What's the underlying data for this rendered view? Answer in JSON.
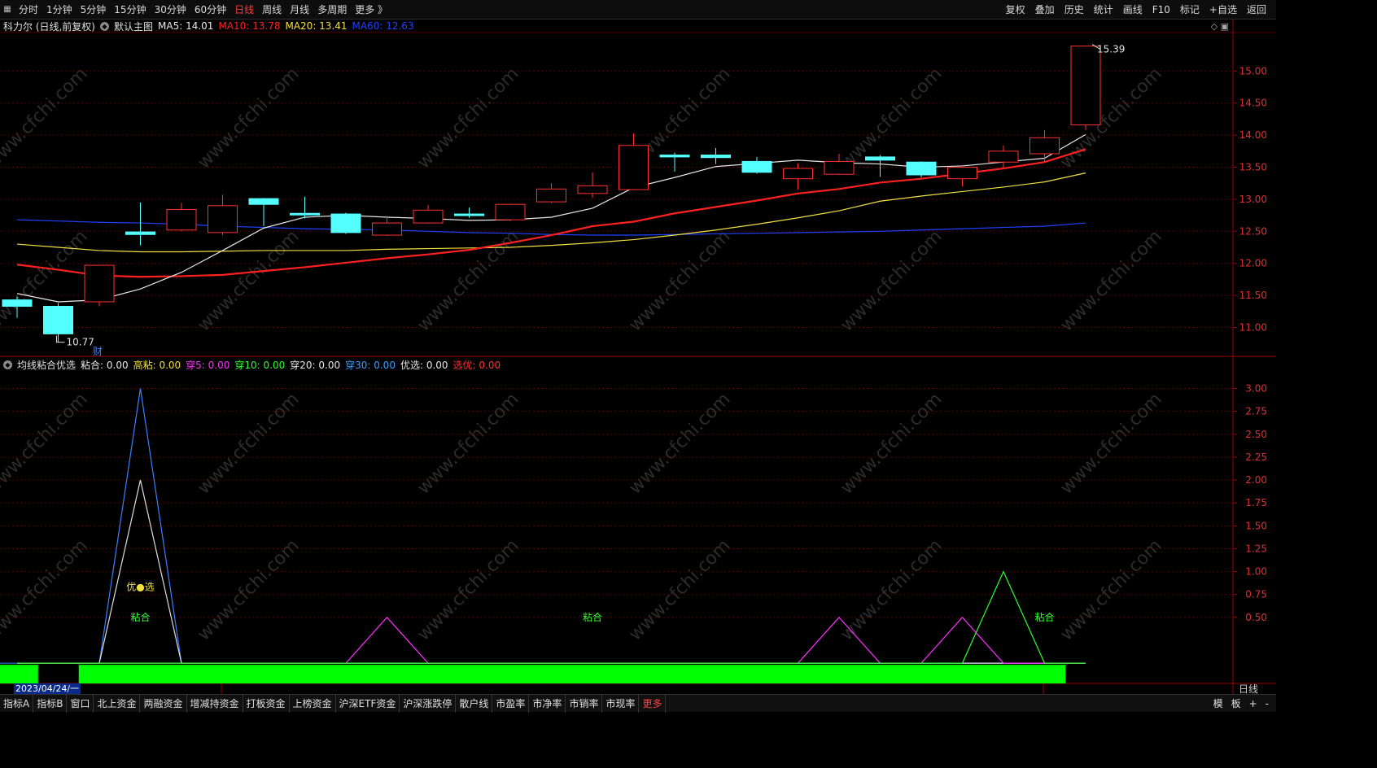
{
  "period_tabs": [
    {
      "label": "分时"
    },
    {
      "label": "1分钟"
    },
    {
      "label": "5分钟"
    },
    {
      "label": "15分钟"
    },
    {
      "label": "30分钟"
    },
    {
      "label": "60分钟"
    },
    {
      "label": "日线",
      "active": true
    },
    {
      "label": "周线"
    },
    {
      "label": "月线"
    },
    {
      "label": "多周期"
    },
    {
      "label": "更多 》"
    }
  ],
  "right_tools": [
    "复权",
    "叠加",
    "历史",
    "统计",
    "画线",
    "F10",
    "标记",
    "+自选",
    "返回"
  ],
  "main_legend": {
    "stock": "科力尔 (日线,前复权)",
    "template": "默认主图",
    "ma5": {
      "label": "MA5: 14.01",
      "color": "#e8e8e8"
    },
    "ma10": {
      "label": "MA10: 13.78",
      "color": "#ff2020"
    },
    "ma20": {
      "label": "MA20: 13.41",
      "color": "#f0e040"
    },
    "ma60": {
      "label": "MA60: 12.63",
      "color": "#2040ff"
    }
  },
  "indicator_legend": {
    "name": "均线粘合优选",
    "items": [
      {
        "label": "粘合: 0.00",
        "color": "#e8e8e8"
      },
      {
        "label": "高粘: 0.00",
        "color": "#f0e040"
      },
      {
        "label": "穿5: 0.00",
        "color": "#ff30ff"
      },
      {
        "label": "穿10: 0.00",
        "color": "#30ff30"
      },
      {
        "label": "穿20: 0.00",
        "color": "#e8e8e8"
      },
      {
        "label": "穿30: 0.00",
        "color": "#3aa0ff"
      },
      {
        "label": "优选: 0.00",
        "color": "#e8e8e8"
      },
      {
        "label": "选优: 0.00",
        "color": "#ff3030"
      }
    ]
  },
  "bottom_tabs": [
    "指标A",
    "指标B",
    "窗口",
    "北上资金",
    "两融资金",
    "增减持资金",
    "打板资金",
    "上榜资金",
    "沪深ETF资金",
    "沪深涨跌停",
    "散户线",
    "市盈率",
    "市净率",
    "市销率",
    "市现率",
    "更多"
  ],
  "bottom_right": [
    "模",
    "板",
    "+",
    "-"
  ],
  "date_label": "2023/04/24/一",
  "period_label": "日线",
  "watermark": "www.cfchi.com",
  "chart_data": [
    {
      "type": "candlestick",
      "ylim": [
        10.6,
        15.55
      ],
      "yticks": [
        "11.00",
        "11.50",
        "12.00",
        "12.50",
        "13.00",
        "13.50",
        "14.00",
        "14.50",
        "15.00"
      ],
      "candles": [
        {
          "o": 11.43,
          "c": 11.33,
          "h": 11.48,
          "l": 11.15
        },
        {
          "o": 11.33,
          "c": 10.9,
          "h": 11.38,
          "l": 10.77
        },
        {
          "o": 11.4,
          "c": 11.97,
          "h": 11.97,
          "l": 11.33
        },
        {
          "o": 12.49,
          "c": 12.45,
          "h": 12.95,
          "l": 12.28
        },
        {
          "o": 12.52,
          "c": 12.84,
          "h": 12.94,
          "l": 12.5
        },
        {
          "o": 12.48,
          "c": 12.9,
          "h": 13.07,
          "l": 12.44
        },
        {
          "o": 13.01,
          "c": 12.92,
          "h": 13.02,
          "l": 12.58
        },
        {
          "o": 12.78,
          "c": 12.77,
          "h": 13.04,
          "l": 12.7
        },
        {
          "o": 12.77,
          "c": 12.48,
          "h": 12.79,
          "l": 12.46
        },
        {
          "o": 12.44,
          "c": 12.63,
          "h": 12.74,
          "l": 12.43
        },
        {
          "o": 12.63,
          "c": 12.83,
          "h": 12.91,
          "l": 12.62
        },
        {
          "o": 12.77,
          "c": 12.76,
          "h": 12.87,
          "l": 12.71
        },
        {
          "o": 12.68,
          "c": 12.92,
          "h": 12.93,
          "l": 12.66
        },
        {
          "o": 12.96,
          "c": 13.16,
          "h": 13.25,
          "l": 12.94
        },
        {
          "o": 13.09,
          "c": 13.21,
          "h": 13.42,
          "l": 13.02
        },
        {
          "o": 13.15,
          "c": 13.84,
          "h": 14.03,
          "l": 13.14
        },
        {
          "o": 13.69,
          "c": 13.66,
          "h": 13.73,
          "l": 13.43
        },
        {
          "o": 13.69,
          "c": 13.65,
          "h": 13.8,
          "l": 13.55
        },
        {
          "o": 13.59,
          "c": 13.42,
          "h": 13.66,
          "l": 13.4
        },
        {
          "o": 13.32,
          "c": 13.48,
          "h": 13.56,
          "l": 13.15
        },
        {
          "o": 13.39,
          "c": 13.59,
          "h": 13.71,
          "l": 13.38
        },
        {
          "o": 13.66,
          "c": 13.61,
          "h": 13.69,
          "l": 13.35
        },
        {
          "o": 13.58,
          "c": 13.38,
          "h": 13.59,
          "l": 13.34
        },
        {
          "o": 13.32,
          "c": 13.5,
          "h": 13.52,
          "l": 13.2
        },
        {
          "o": 13.58,
          "c": 13.75,
          "h": 13.84,
          "l": 13.48
        },
        {
          "o": 13.71,
          "c": 13.96,
          "h": 14.08,
          "l": 13.58
        },
        {
          "o": 14.16,
          "c": 15.39,
          "h": 15.39,
          "l": 14.08
        }
      ],
      "ma5": [
        11.53,
        11.4,
        11.43,
        11.6,
        11.86,
        12.2,
        12.55,
        12.72,
        12.75,
        12.72,
        12.7,
        12.67,
        12.68,
        12.72,
        12.86,
        13.18,
        13.34,
        13.51,
        13.56,
        13.61,
        13.57,
        13.55,
        13.5,
        13.52,
        13.58,
        13.64,
        14.01
      ],
      "ma10": [
        11.98,
        11.9,
        11.81,
        11.79,
        11.8,
        11.82,
        11.88,
        11.94,
        12.01,
        12.08,
        12.14,
        12.21,
        12.32,
        12.44,
        12.58,
        12.65,
        12.78,
        12.88,
        12.98,
        13.09,
        13.16,
        13.26,
        13.32,
        13.4,
        13.48,
        13.58,
        13.78
      ],
      "ma20": [
        12.3,
        12.25,
        12.2,
        12.18,
        12.18,
        12.19,
        12.2,
        12.2,
        12.2,
        12.22,
        12.23,
        12.24,
        12.25,
        12.28,
        12.32,
        12.37,
        12.44,
        12.52,
        12.61,
        12.71,
        12.82,
        12.97,
        13.05,
        13.12,
        13.19,
        13.27,
        13.41
      ],
      "ma60": [
        12.68,
        12.66,
        12.64,
        12.63,
        12.61,
        12.58,
        12.56,
        12.54,
        12.53,
        12.52,
        12.5,
        12.48,
        12.47,
        12.45,
        12.44,
        12.44,
        12.45,
        12.46,
        12.47,
        12.48,
        12.49,
        12.5,
        12.52,
        12.54,
        12.56,
        12.58,
        12.63
      ],
      "max_label": "15.39",
      "min_label": "10.77",
      "event_marker": "财"
    },
    {
      "type": "line",
      "ylim": [
        -0.15,
        3.2
      ],
      "yticks": [
        "0.50",
        "0.75",
        "1.00",
        "1.25",
        "1.50",
        "1.75",
        "2.00",
        "2.25",
        "2.50",
        "2.75",
        "3.00"
      ],
      "series": [
        {
          "values": [
            0,
            0,
            0,
            3,
            0,
            0,
            0,
            0,
            0,
            0,
            0,
            0,
            0,
            0,
            0,
            0,
            0,
            0,
            0,
            0,
            0,
            0,
            0,
            0,
            0,
            0,
            0
          ],
          "color": "#3a80ff"
        },
        {
          "values": [
            0,
            0,
            0,
            2,
            0,
            0,
            0,
            0,
            0,
            0,
            0,
            0,
            0,
            0,
            0,
            0,
            0,
            0,
            0,
            0,
            0,
            0,
            0,
            0,
            0,
            0,
            0
          ],
          "color": "#e0e0e0"
        },
        {
          "values": [
            0,
            0,
            0,
            0,
            0,
            0,
            0,
            0,
            0,
            0.5,
            0,
            0,
            0,
            0,
            0,
            0,
            0,
            0,
            0,
            0,
            0.5,
            0,
            0,
            0.5,
            0,
            0,
            0
          ],
          "color": "#ff30ff"
        },
        {
          "values": [
            0,
            0,
            0,
            0,
            0,
            0,
            0,
            0,
            0,
            0,
            0,
            0,
            0,
            0,
            0,
            0,
            0,
            0,
            0,
            0,
            0,
            0,
            0,
            0,
            1,
            0,
            0
          ],
          "color": "#30ff30"
        }
      ],
      "annotations": [
        {
          "text": "优●选",
          "index": 3,
          "y": 0.83,
          "color": "#f0e040"
        },
        {
          "text": "粘合",
          "index": 3,
          "y": 0.5,
          "color": "#30ff30"
        },
        {
          "text": "粘合",
          "index": 14,
          "y": 0.5,
          "color": "#30ff30"
        },
        {
          "text": "粘合",
          "index": 25,
          "y": 0.5,
          "color": "#30ff30"
        }
      ],
      "green_band": [
        1,
        0,
        1,
        1,
        1,
        1,
        1,
        1,
        1,
        1,
        1,
        1,
        1,
        1,
        1,
        1,
        1,
        1,
        1,
        1,
        1,
        1,
        1,
        1,
        1,
        1,
        0
      ]
    }
  ]
}
